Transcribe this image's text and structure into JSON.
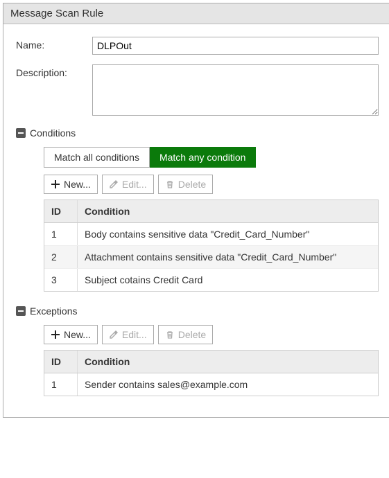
{
  "panel_title": "Message Scan Rule",
  "form": {
    "name_label": "Name:",
    "name_value": "DLPOut",
    "description_label": "Description:",
    "description_value": ""
  },
  "sections": {
    "conditions": {
      "title": "Conditions",
      "match_all_label": "Match all conditions",
      "match_any_label": "Match any condition",
      "active": "any",
      "toolbar": {
        "new": "New...",
        "edit": "Edit...",
        "delete": "Delete"
      },
      "columns": {
        "id": "ID",
        "condition": "Condition"
      },
      "rows": [
        {
          "id": "1",
          "condition": "Body contains sensitive data \"Credit_Card_Number\""
        },
        {
          "id": "2",
          "condition": "Attachment contains sensitive data \"Credit_Card_Number\""
        },
        {
          "id": "3",
          "condition": "Subject cotains Credit Card"
        }
      ]
    },
    "exceptions": {
      "title": "Exceptions",
      "toolbar": {
        "new": "New...",
        "edit": "Edit...",
        "delete": "Delete"
      },
      "columns": {
        "id": "ID",
        "condition": "Condition"
      },
      "rows": [
        {
          "id": "1",
          "condition": "Sender contains sales@example.com"
        }
      ]
    }
  }
}
